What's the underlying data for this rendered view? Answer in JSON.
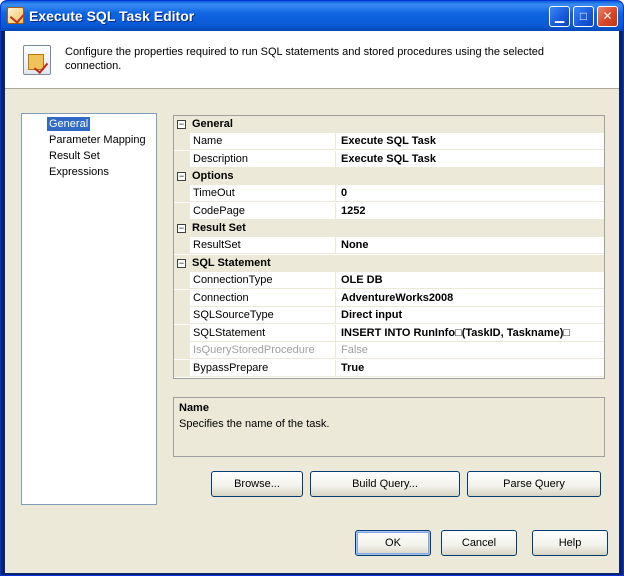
{
  "window": {
    "title": "Execute SQL Task Editor",
    "controls": {
      "minimize": "▁",
      "maximize": "□",
      "close": "✕"
    }
  },
  "banner": {
    "text": "Configure the properties required to run SQL statements and stored procedures using the selected connection."
  },
  "nav": {
    "items": [
      {
        "label": "General",
        "selected": true
      },
      {
        "label": "Parameter Mapping",
        "selected": false
      },
      {
        "label": "Result Set",
        "selected": false
      },
      {
        "label": "Expressions",
        "selected": false
      }
    ]
  },
  "grid": {
    "categories": [
      {
        "label": "General",
        "toggle": "⊟",
        "rows": [
          {
            "name": "Name",
            "value": "Execute SQL Task"
          },
          {
            "name": "Description",
            "value": "Execute SQL Task"
          }
        ]
      },
      {
        "label": "Options",
        "toggle": "⊟",
        "rows": [
          {
            "name": "TimeOut",
            "value": "0"
          },
          {
            "name": "CodePage",
            "value": "1252"
          }
        ]
      },
      {
        "label": "Result Set",
        "toggle": "⊟",
        "rows": [
          {
            "name": "ResultSet",
            "value": "None"
          }
        ]
      },
      {
        "label": "SQL Statement",
        "toggle": "⊟",
        "rows": [
          {
            "name": "ConnectionType",
            "value": "OLE DB"
          },
          {
            "name": "Connection",
            "value": "AdventureWorks2008"
          },
          {
            "name": "SQLSourceType",
            "value": "Direct input"
          },
          {
            "name": "SQLStatement",
            "value": "INSERT INTO RunInfo□(TaskID, Taskname)□"
          },
          {
            "name": "IsQueryStoredProcedure",
            "value": "False",
            "disabled": true
          },
          {
            "name": "BypassPrepare",
            "value": "True"
          }
        ]
      }
    ]
  },
  "description": {
    "title": "Name",
    "text": "Specifies the name of the task."
  },
  "buttons": {
    "browse": "Browse...",
    "build_query": "Build Query...",
    "parse_query": "Parse Query",
    "ok": "OK",
    "cancel": "Cancel",
    "help": "Help"
  }
}
